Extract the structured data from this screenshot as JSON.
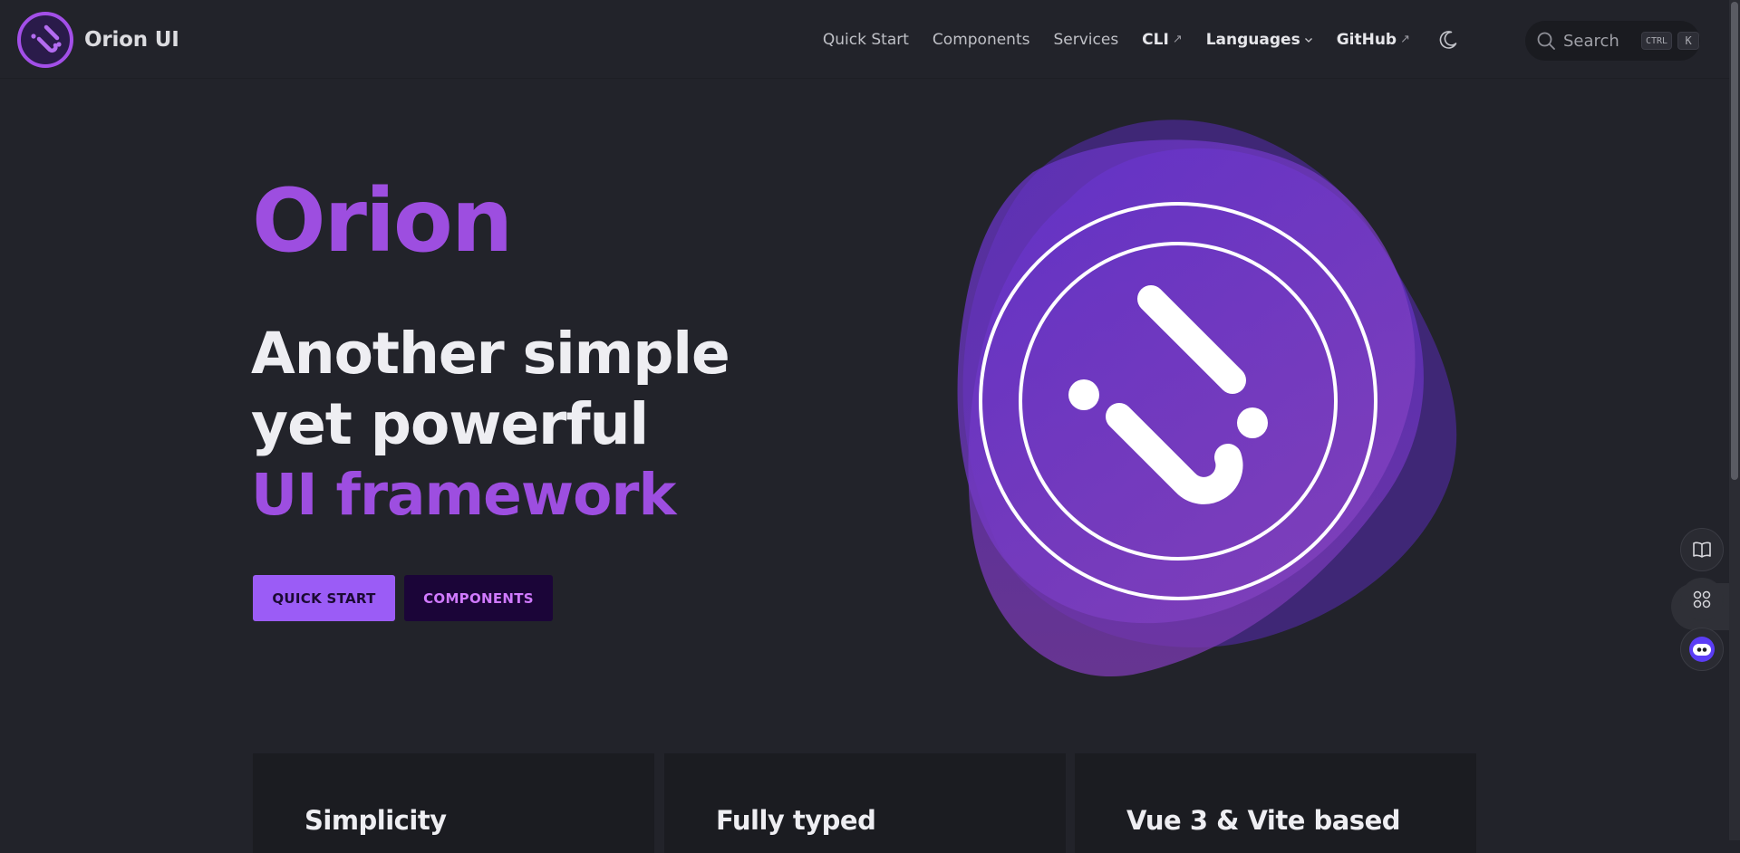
{
  "brand": {
    "name": "Orion UI"
  },
  "nav": {
    "quick_start": "Quick Start",
    "components": "Components",
    "services": "Services",
    "cli": "CLI",
    "cli_ext": "↗",
    "languages": "Languages",
    "github": "GitHub",
    "github_ext": "↗"
  },
  "search": {
    "placeholder": "Search",
    "key_ctrl": "CTRL",
    "key_k": "K"
  },
  "hero": {
    "title": "Orion",
    "tagline_line1": "Another simple",
    "tagline_line2": "yet powerful",
    "tagline_accent": "UI framework",
    "primary_button": "QUICK START",
    "secondary_button": "COMPONENTS"
  },
  "features": [
    {
      "title": "Simplicity"
    },
    {
      "title": "Fully typed"
    },
    {
      "title": "Vue 3 & Vite based"
    }
  ],
  "colors": {
    "background": "#22232a",
    "accent": "#9d4ee0",
    "primary_button": "#9b5cf6",
    "secondary_button": "#1b0538"
  },
  "icons": {
    "brand": "orion-logo-icon",
    "theme": "moon-icon",
    "search": "search-icon",
    "float_1": "book-icon",
    "float_2": "grid-icon",
    "float_3": "chat-bot-icon"
  }
}
